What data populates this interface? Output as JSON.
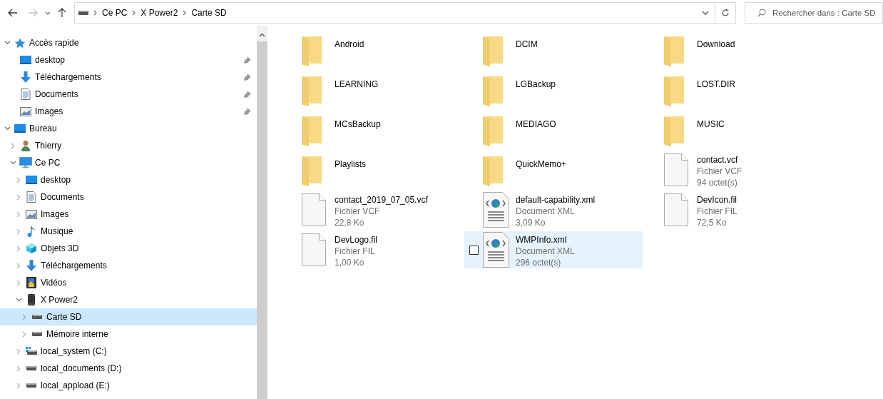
{
  "toolbar": {
    "back_disabled": false,
    "forward_disabled": true
  },
  "address": {
    "crumbs": [
      "Ce PC",
      "X Power2",
      "Carte SD"
    ]
  },
  "search": {
    "placeholder": "Rechercher dans : Carte SD"
  },
  "sidebar": {
    "items": [
      {
        "label": "Accès rapide",
        "expanded": true,
        "selected": false,
        "children": [
          {
            "label": "desktop",
            "pinned": true,
            "selected": false
          },
          {
            "label": "Téléchargements",
            "pinned": true,
            "selected": false
          },
          {
            "label": "Documents",
            "pinned": true,
            "selected": false
          },
          {
            "label": "Images",
            "pinned": true,
            "selected": false
          }
        ]
      },
      {
        "label": "Bureau",
        "expanded": true,
        "selected": false,
        "children": [
          {
            "label": "Thierry",
            "expanded": false,
            "selected": false
          },
          {
            "label": "Ce PC",
            "expanded": true,
            "selected": false,
            "children": [
              {
                "label": "desktop",
                "expanded": false,
                "selected": false
              },
              {
                "label": "Documents",
                "expanded": false,
                "selected": false
              },
              {
                "label": "Images",
                "expanded": false,
                "selected": false
              },
              {
                "label": "Musique",
                "expanded": false,
                "selected": false
              },
              {
                "label": "Objets 3D",
                "expanded": false,
                "selected": false
              },
              {
                "label": "Téléchargements",
                "expanded": false,
                "selected": false
              },
              {
                "label": "Vidéos",
                "expanded": false,
                "selected": false
              },
              {
                "label": "X Power2",
                "expanded": true,
                "selected": false,
                "children": [
                  {
                    "label": "Carte SD",
                    "expanded": false,
                    "selected": true
                  },
                  {
                    "label": "Mémoire interne",
                    "expanded": false,
                    "selected": false
                  }
                ]
              },
              {
                "label": "local_system (C:)",
                "expanded": false,
                "selected": false
              },
              {
                "label": "local_documents (D:)",
                "expanded": false,
                "selected": false
              },
              {
                "label": "local_appload (E:)",
                "expanded": false,
                "selected": false
              }
            ]
          }
        ]
      }
    ]
  },
  "files": [
    {
      "kind": "folder",
      "name": "Android",
      "hovered": false
    },
    {
      "kind": "folder",
      "name": "DCIM",
      "hovered": false
    },
    {
      "kind": "folder",
      "name": "Download",
      "hovered": false
    },
    {
      "kind": "folder",
      "name": "LEARNING",
      "hovered": false
    },
    {
      "kind": "folder",
      "name": "LGBackup",
      "hovered": false
    },
    {
      "kind": "folder",
      "name": "LOST.DIR",
      "hovered": false
    },
    {
      "kind": "folder",
      "name": "MCsBackup",
      "hovered": false
    },
    {
      "kind": "folder",
      "name": "MEDIAGO",
      "hovered": false
    },
    {
      "kind": "folder",
      "name": "MUSIC",
      "hovered": false
    },
    {
      "kind": "folder",
      "name": "Playlists",
      "hovered": false
    },
    {
      "kind": "folder",
      "name": "QuickMemo+",
      "hovered": false
    },
    {
      "kind": "file",
      "name": "contact.vcf",
      "type": "Fichier VCF",
      "size": "94 octet(s)",
      "hovered": false
    },
    {
      "kind": "file",
      "name": "contact_2019_07_05.vcf",
      "type": "Fichier VCF",
      "size": "22,8 Ko",
      "hovered": false
    },
    {
      "kind": "xml",
      "name": "default-capability.xml",
      "type": "Document XML",
      "size": "3,09 Ko",
      "hovered": false
    },
    {
      "kind": "file",
      "name": "DevIcon.fil",
      "type": "Fichier FIL",
      "size": "72,5 Ko",
      "hovered": false
    },
    {
      "kind": "file",
      "name": "DevLogo.fil",
      "type": "Fichier FIL",
      "size": "1,00 Ko",
      "hovered": false
    },
    {
      "kind": "xml",
      "name": "WMPInfo.xml",
      "type": "Document XML",
      "size": "296 octet(s)",
      "hovered": true,
      "checked": false
    }
  ]
}
